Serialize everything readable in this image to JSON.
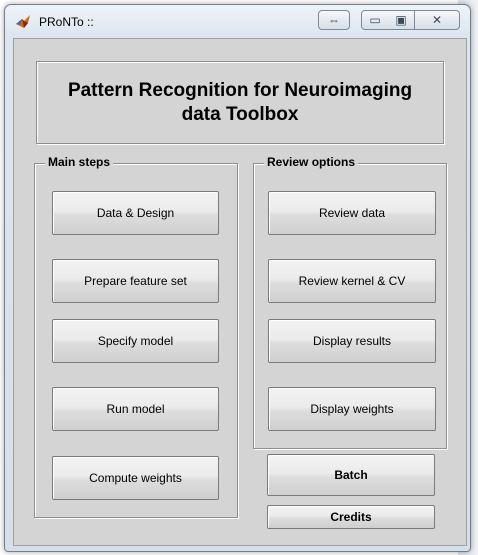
{
  "window": {
    "title": "PRoNTo ::",
    "caption_restore_arrows": "⇔",
    "caption_minimize": "▭",
    "caption_maximize": "▣",
    "caption_close": "✕"
  },
  "header": {
    "title_line1": "Pattern Recognition for Neuroimaging",
    "title_line2": "data Toolbox"
  },
  "main_steps": {
    "label": "Main steps",
    "buttons": [
      "Data & Design",
      "Prepare feature set",
      "Specify model",
      "Run model",
      "Compute weights"
    ]
  },
  "review_options": {
    "label": "Review options",
    "buttons": [
      "Review data",
      "Review kernel & CV",
      "Display results",
      "Display weights"
    ]
  },
  "bottom": {
    "batch_label": "Batch",
    "credits_label": "Credits"
  },
  "colors": {
    "panel_bg": "#d4d4d4",
    "titlebar_bg": "#dde6ef"
  }
}
